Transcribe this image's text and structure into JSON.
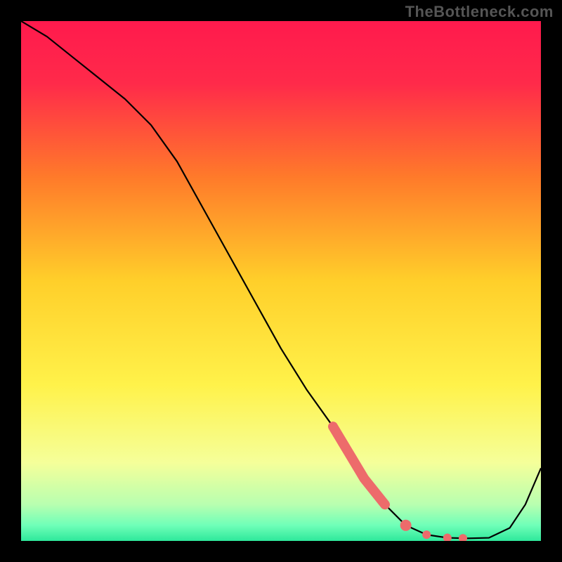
{
  "watermark": "TheBottleneck.com",
  "chart_data": {
    "type": "line",
    "title": "",
    "xlabel": "",
    "ylabel": "",
    "xlim": [
      0,
      100
    ],
    "ylim": [
      0,
      100
    ],
    "background_gradient": {
      "top": "#ff1a4d",
      "mid_upper": "#ff8c1a",
      "mid": "#ffe61a",
      "mid_lower": "#d4ff7a",
      "bottom": "#2ee89b"
    },
    "curve": {
      "x": [
        0,
        5,
        10,
        15,
        20,
        25,
        30,
        35,
        40,
        45,
        50,
        55,
        60,
        63,
        66,
        70,
        74,
        78,
        82,
        86,
        90,
        94,
        97,
        100
      ],
      "y": [
        100,
        97,
        93,
        89,
        85,
        80,
        73,
        64,
        55,
        46,
        37,
        29,
        22,
        17,
        12,
        7,
        3,
        1.2,
        0.6,
        0.5,
        0.6,
        2.5,
        7,
        14
      ]
    },
    "highlight_segment": {
      "x": [
        60,
        63,
        66,
        70
      ],
      "y": [
        22,
        17,
        12,
        7
      ]
    },
    "highlight_points": [
      {
        "x": 74,
        "y": 3
      },
      {
        "x": 78,
        "y": 1.2
      },
      {
        "x": 82,
        "y": 0.6
      },
      {
        "x": 85,
        "y": 0.5
      }
    ],
    "highlight_color": "#ed6b6b"
  }
}
